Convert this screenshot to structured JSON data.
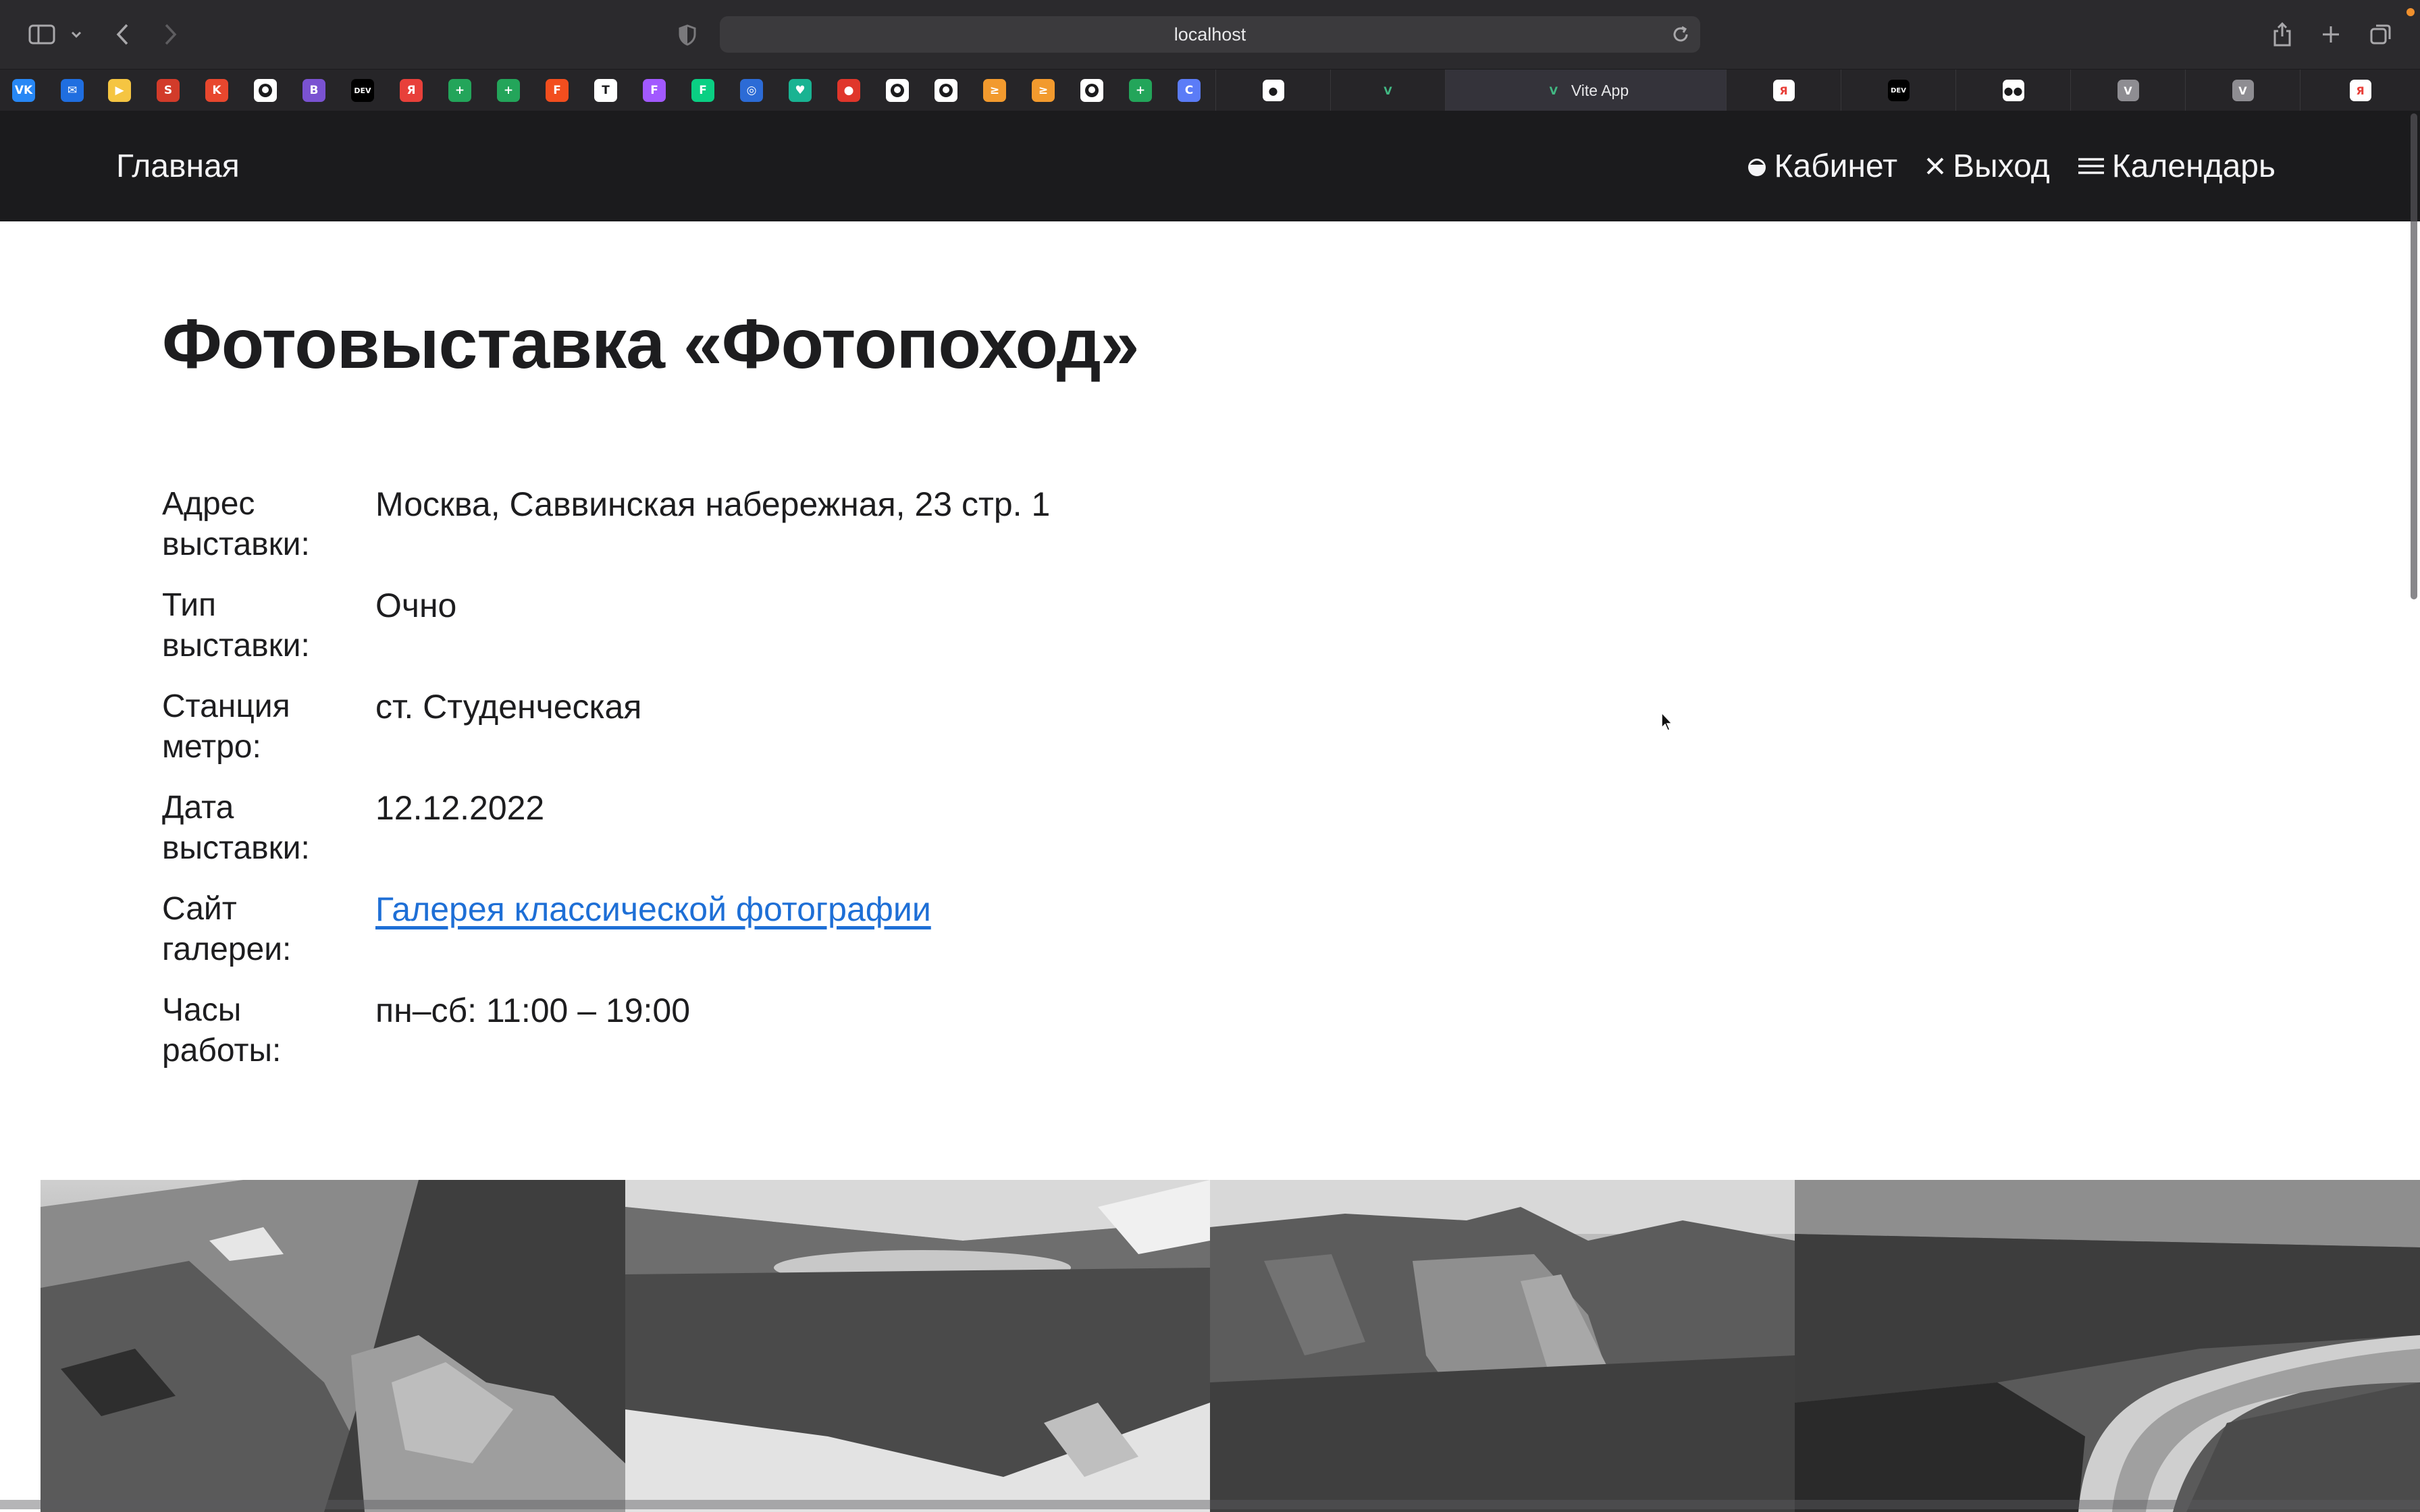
{
  "browser": {
    "url": "localhost",
    "tabs": [
      {
        "label": "",
        "icon": "github-icon"
      },
      {
        "label": "",
        "icon": "vue-icon"
      },
      {
        "label": "Vite App",
        "icon": "vue-icon",
        "active": true
      },
      {
        "label": "",
        "icon": "yandex-icon"
      },
      {
        "label": "",
        "icon": "dev-icon"
      },
      {
        "label": "",
        "icon": "medium-icon"
      },
      {
        "label": "",
        "icon": "v-icon"
      },
      {
        "label": "",
        "icon": "v-icon"
      },
      {
        "label": "",
        "icon": "yandex-icon"
      }
    ],
    "bookmarks": [
      {
        "glyph": "VK",
        "color": "#2787f5"
      },
      {
        "glyph": "✉",
        "color": "#1f6ee0"
      },
      {
        "glyph": "▶",
        "color": "#f5c542"
      },
      {
        "glyph": "S",
        "color": "#d23b2a"
      },
      {
        "glyph": "K",
        "color": "#e8472e"
      },
      {
        "glyph": "",
        "color": "#ffffff"
      },
      {
        "glyph": "B",
        "color": "#7a52d1"
      },
      {
        "glyph": "DEV",
        "color": "#000000"
      },
      {
        "glyph": "Я",
        "color": "#e8403a"
      },
      {
        "glyph": "+",
        "color": "#23a55a"
      },
      {
        "glyph": "+",
        "color": "#23a55a"
      },
      {
        "glyph": "F",
        "color": "#f24e1e"
      },
      {
        "glyph": "T",
        "color": "#ffffff"
      },
      {
        "glyph": "F",
        "color": "#a259ff"
      },
      {
        "glyph": "F",
        "color": "#0acf83"
      },
      {
        "glyph": "◎",
        "color": "#2c6bd6"
      },
      {
        "glyph": "♥",
        "color": "#19b392"
      },
      {
        "glyph": "●",
        "color": "#e0362b"
      },
      {
        "glyph": "",
        "color": "#ffffff"
      },
      {
        "glyph": "",
        "color": "#ffffff"
      },
      {
        "glyph": "≥",
        "color": "#f29a2e"
      },
      {
        "glyph": "≥",
        "color": "#f29a2e"
      },
      {
        "glyph": "",
        "color": "#ffffff"
      },
      {
        "glyph": "+",
        "color": "#23a55a"
      },
      {
        "glyph": "C",
        "color": "#5b7cf7"
      }
    ]
  },
  "header": {
    "brand": "Главная",
    "nav": [
      {
        "label": "Кабинет",
        "icon": "user-icon"
      },
      {
        "label": "Выход",
        "icon": "close-icon"
      },
      {
        "label": "Календарь",
        "icon": "menu-icon"
      }
    ]
  },
  "page": {
    "title": "Фотовыставка «Фотопоход»",
    "details": [
      {
        "label_1": "Адрес",
        "label_2": "выставки:",
        "value": "Москва, Саввинская набережная, 23 стр. 1"
      },
      {
        "label_1": "Тип",
        "label_2": "выставки:",
        "value": "Очно"
      },
      {
        "label_1": "Станция",
        "label_2": "метро:",
        "value": "ст. Студенческая"
      },
      {
        "label_1": "Дата",
        "label_2": "выставки:",
        "value": "12.12.2022"
      },
      {
        "label_1": "Сайт",
        "label_2": "галереи:",
        "value": "Галерея классической фотографии",
        "link": true
      },
      {
        "label_1": "Часы",
        "label_2": "работы:",
        "value": "пн–сб: 11:00 – 19:00"
      }
    ],
    "gallery": [
      "mountain-rocks",
      "mountain-lake",
      "mountain-cirque",
      "forest-river"
    ]
  }
}
